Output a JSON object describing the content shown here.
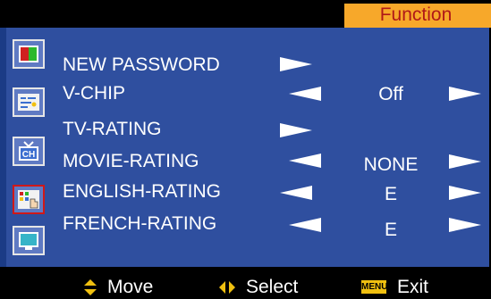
{
  "header": {
    "title": "Function"
  },
  "menu": [
    {
      "label": "NEW PASSWORD"
    },
    {
      "label": "V-CHIP",
      "value": "Off"
    },
    {
      "label": "TV-RATING"
    },
    {
      "label": "MOVIE-RATING",
      "value": "NONE"
    },
    {
      "label": "ENGLISH-RATING",
      "value": "E"
    },
    {
      "label": "FRENCH-RATING",
      "value": "E"
    }
  ],
  "sidebar_icons": [
    {
      "name": "picture-icon"
    },
    {
      "name": "sound-icon"
    },
    {
      "name": "channel-icon",
      "text": "CH"
    },
    {
      "name": "function-icon"
    },
    {
      "name": "screen-icon"
    }
  ],
  "footer": {
    "move_label": "Move",
    "select_label": "Select",
    "menu_key": "MENU",
    "exit_label": "Exit"
  },
  "colors": {
    "panel": "#2f4f9f",
    "title_bg": "#f7a82a",
    "title_text": "#b01818",
    "selected_border": "#d01818"
  }
}
